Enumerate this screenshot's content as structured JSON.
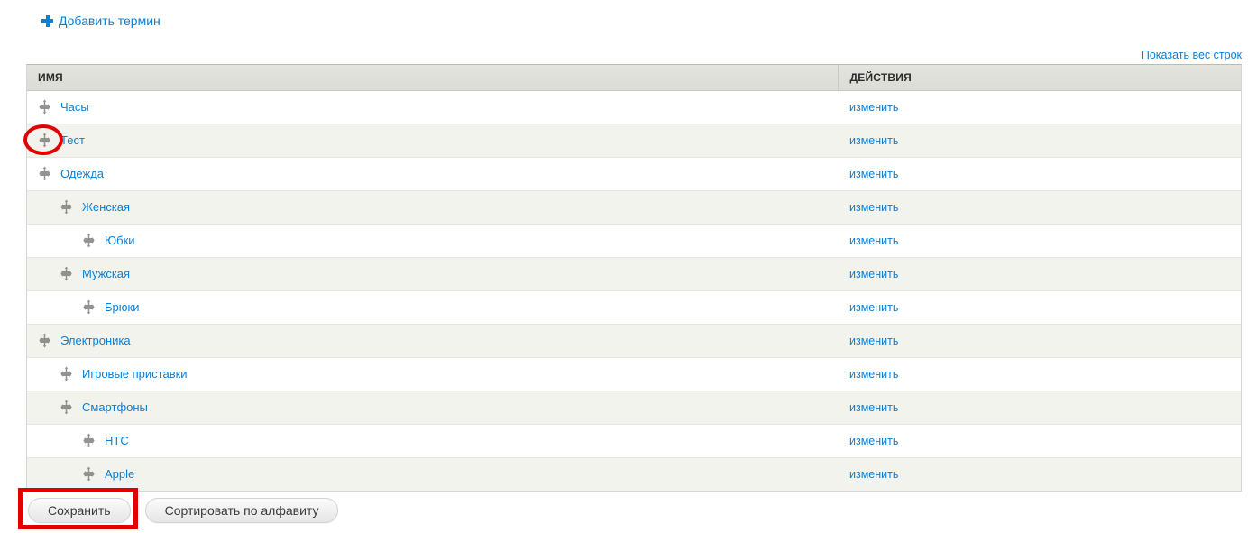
{
  "toolbar": {
    "add_term_label": "Добавить термин",
    "add_term_icon": "plus-icon"
  },
  "links": {
    "show_row_weights": "Показать вес строк"
  },
  "table": {
    "columns": {
      "name": "ИМЯ",
      "actions": "ДЕЙСТВИЯ"
    },
    "action_label": "изменить",
    "drag_icon": "move-arrows-icon",
    "rows": [
      {
        "name": "Часы",
        "depth": 0,
        "action": "изменить"
      },
      {
        "name": "Тест",
        "depth": 0,
        "action": "изменить"
      },
      {
        "name": "Одежда",
        "depth": 0,
        "action": "изменить"
      },
      {
        "name": "Женская",
        "depth": 1,
        "action": "изменить"
      },
      {
        "name": "Юбки",
        "depth": 2,
        "action": "изменить"
      },
      {
        "name": "Мужская",
        "depth": 1,
        "action": "изменить"
      },
      {
        "name": "Брюки",
        "depth": 2,
        "action": "изменить"
      },
      {
        "name": "Электроника",
        "depth": 0,
        "action": "изменить"
      },
      {
        "name": "Игровые приставки",
        "depth": 1,
        "action": "изменить"
      },
      {
        "name": "Смартфоны",
        "depth": 1,
        "action": "изменить"
      },
      {
        "name": "HTC",
        "depth": 2,
        "action": "изменить"
      },
      {
        "name": "Apple",
        "depth": 2,
        "action": "изменить"
      }
    ]
  },
  "buttons": {
    "save": "Сохранить",
    "sort_alphabetically": "Сортировать по алфавиту"
  },
  "annotations": {
    "highlight_color": "#e20000",
    "ellipse_target": "drag-handle of row Тест",
    "rect_target": "Сохранить button"
  },
  "colors": {
    "link": "#0b7fd4",
    "header_bg": "#e0e0da",
    "row_even_bg": "#f3f3ee",
    "row_odd_bg": "#ffffff"
  }
}
